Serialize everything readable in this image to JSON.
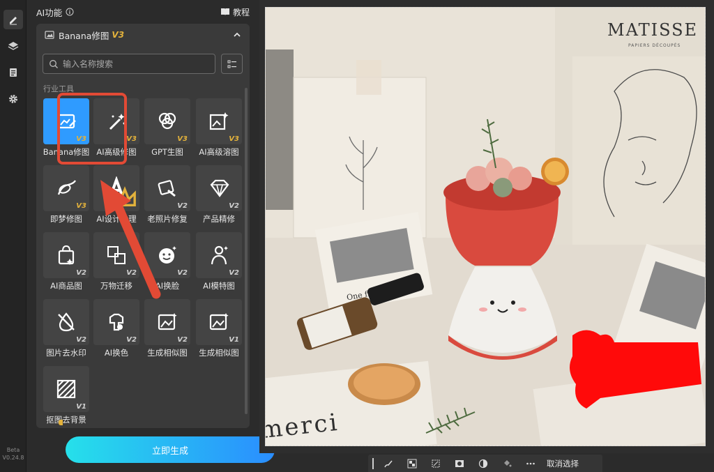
{
  "app": {
    "version": "V0.24.8",
    "beta_label": "Beta"
  },
  "panel": {
    "title": "AI功能",
    "tutorial_label": "教程"
  },
  "feature_card": {
    "title": "Banana修图",
    "version": "V3"
  },
  "search": {
    "placeholder": "输入名称搜索"
  },
  "section": {
    "label": "行业工具"
  },
  "tools": [
    {
      "label": "Banana修图",
      "version": "V3",
      "icon": "image-edit-icon",
      "selected": true
    },
    {
      "label": "AI高级修图",
      "version": "V3",
      "icon": "magic-wand-icon"
    },
    {
      "label": "GPT生图",
      "version": "V3",
      "icon": "gpt-logo-icon"
    },
    {
      "label": "AI高级溶图",
      "version": "V3",
      "icon": "image-sparkle-icon"
    },
    {
      "label": "即梦修图",
      "version": "V3",
      "icon": "dream-brush-icon"
    },
    {
      "label": "AI设计助理",
      "version": "",
      "icon": "design-a-icon",
      "crown": true
    },
    {
      "label": "老照片修复",
      "version": "V2",
      "icon": "photo-restore-icon"
    },
    {
      "label": "产品精修",
      "version": "V2",
      "icon": "diamond-icon"
    },
    {
      "label": "AI商品图",
      "version": "V2",
      "icon": "shopping-bag-icon"
    },
    {
      "label": "万物迁移",
      "version": "V2",
      "icon": "transfer-image-icon"
    },
    {
      "label": "AI换脸",
      "version": "V2",
      "icon": "face-swap-icon"
    },
    {
      "label": "AI模特图",
      "version": "V2",
      "icon": "model-person-icon"
    },
    {
      "label": "图片去水印",
      "version": "V2",
      "icon": "remove-watermark-icon"
    },
    {
      "label": "AI换色",
      "version": "V2",
      "icon": "color-change-icon"
    },
    {
      "label": "生成相似图",
      "version": "V2",
      "icon": "similar-image-icon"
    },
    {
      "label": "生成相似图",
      "version": "V1",
      "icon": "similar-image-icon"
    },
    {
      "label": "抠图去背景",
      "version": "V1",
      "icon": "remove-bg-icon"
    }
  ],
  "generate_button": {
    "label": "立即生成"
  },
  "bottom_toolbar": {
    "deselect_label": "取消选择"
  },
  "image": {
    "poster_title": "MATISSE",
    "poster_subtitle": "PAPIERS DÉCOUPÉS",
    "card_text": "One fine day",
    "merci_text": "merci"
  },
  "colors": {
    "accent": "#2f9bff",
    "gold": "#e3b23c",
    "highlight_red": "#e24a35",
    "generate_start": "#26e0ea",
    "generate_end": "#2a8dff"
  }
}
